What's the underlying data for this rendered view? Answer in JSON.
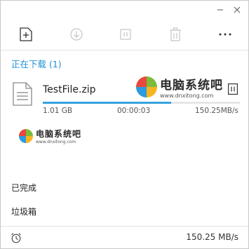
{
  "window": {
    "minimize_icon": "minimize-icon",
    "close_icon": "close-icon"
  },
  "toolbar": {
    "new_task_icon": "new-task-icon",
    "start_icon": "download-start-icon",
    "pause_icon": "pause-icon",
    "delete_icon": "trash-icon",
    "more_icon": "more-icon"
  },
  "sections": {
    "downloading": "正在下载 (1)",
    "completed": "已完成",
    "trash": "垃圾箱"
  },
  "task": {
    "file_name": "TestFile.zip",
    "size": "1.01 GB",
    "elapsed": "00:00:03",
    "speed": "150.25MB/s",
    "progress": 0.65
  },
  "watermark": {
    "title": "电脑系统吧",
    "url": "www.dnxitong.com"
  },
  "status_bar": {
    "total_speed": "150.25 MB/s"
  },
  "colors": {
    "accent": "#1e8fd6",
    "progress": "#36a3dc",
    "logo_red": "#e9483f",
    "logo_green": "#7cbc3a",
    "logo_blue": "#2c9be0",
    "logo_yellow": "#f6b51e"
  }
}
